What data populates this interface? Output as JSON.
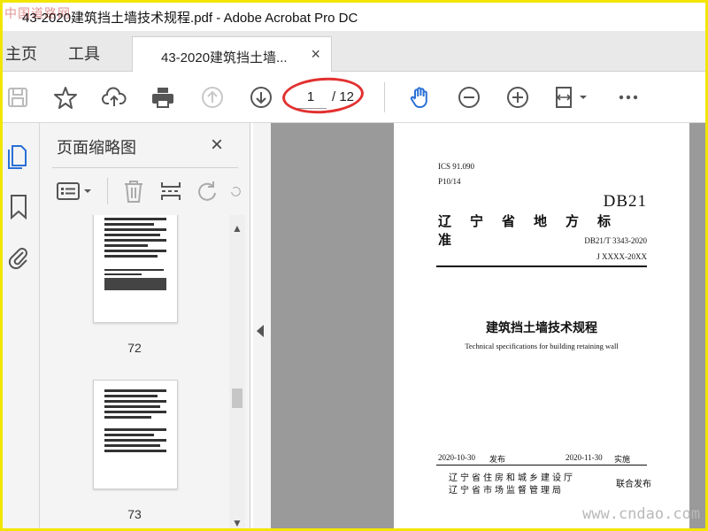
{
  "window": {
    "title": "43-2020建筑挡土墙技术规程.pdf - Adobe Acrobat Pro DC",
    "watermark_top": "中国道路网"
  },
  "tabs": {
    "home": "主页",
    "tools": "工具",
    "document": "43-2020建筑挡土墙...",
    "close": "×"
  },
  "toolbar": {
    "current_page": "1",
    "total_pages": "/ 12",
    "highlight_color": "#e23030",
    "icons": [
      "save-icon",
      "star-icon",
      "upload-icon",
      "print-icon",
      "page-up-icon",
      "page-down-icon",
      "hand-icon",
      "zoom-out-icon",
      "zoom-in-icon",
      "fit-page-icon",
      "more-icon"
    ]
  },
  "panel": {
    "title": "页面缩略图",
    "close": "×",
    "thumbnails": [
      {
        "label": "72"
      },
      {
        "label": "73"
      }
    ]
  },
  "document": {
    "ics": "ICS 91.090",
    "class": "P10/14",
    "db": "DB21",
    "province_std": "辽宁省地方标准",
    "std_no": "DB21/T 3343-2020",
    "record_no": "J    XXXX-20XX",
    "title_zh": "建筑挡土墙技术规程",
    "title_en": "Technical specifications for building retaining wall",
    "publish_date": "2020-10-30",
    "publish_label": "发布",
    "implement_date": "2020-11-30",
    "implement_label": "实施",
    "issuer1": "辽宁省住房和城乡建设厅",
    "issuer2": "辽宁省市场监督管理局",
    "joint": "联合发布"
  },
  "watermark_bottom": "www.cndao.com",
  "colors": {
    "accent_blue": "#2a6fd6",
    "frame_yellow": "#f2e600"
  }
}
